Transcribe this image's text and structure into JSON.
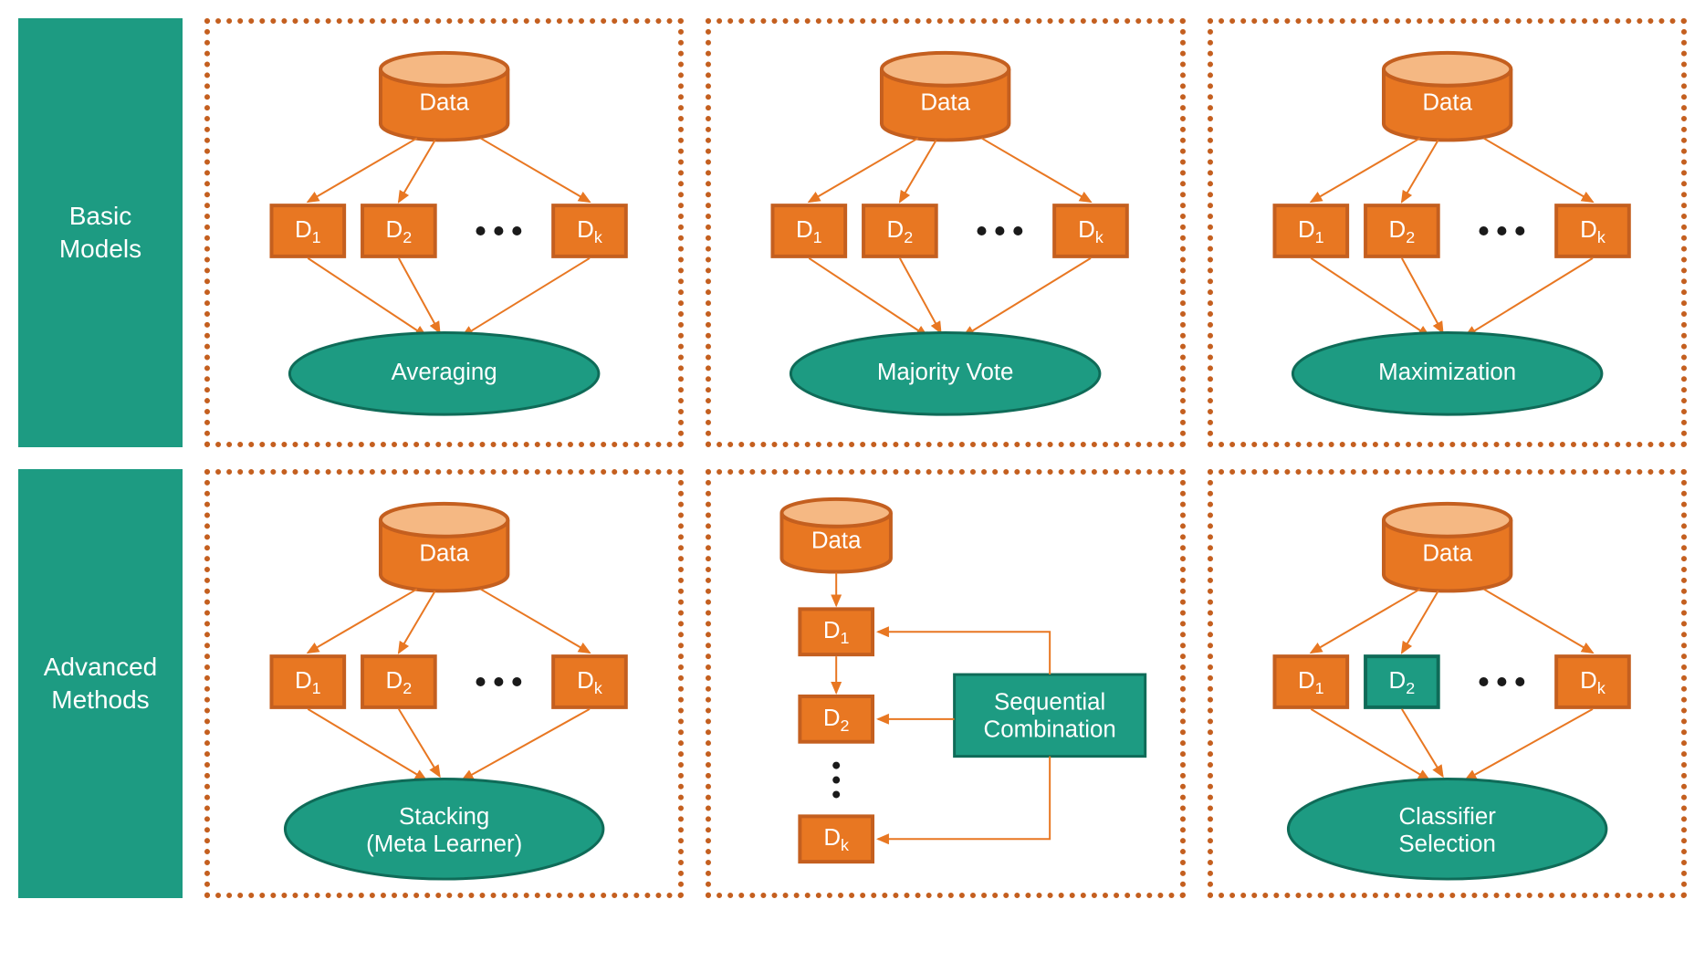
{
  "rows": {
    "basic": "Basic\nModels",
    "advanced": "Advanced\nMethods"
  },
  "common": {
    "data": "Data",
    "d1": "D",
    "d1sub": "1",
    "d2": "D",
    "d2sub": "2",
    "dk": "D",
    "dksub": "k"
  },
  "panels": {
    "averaging": "Averaging",
    "majority": "Majority Vote",
    "maximization": "Maximization",
    "stacking_l1": "Stacking",
    "stacking_l2": "(Meta Learner)",
    "sequential_l1": "Sequential",
    "sequential_l2": "Combination",
    "classifier_l1": "Classifier",
    "classifier_l2": "Selection"
  }
}
